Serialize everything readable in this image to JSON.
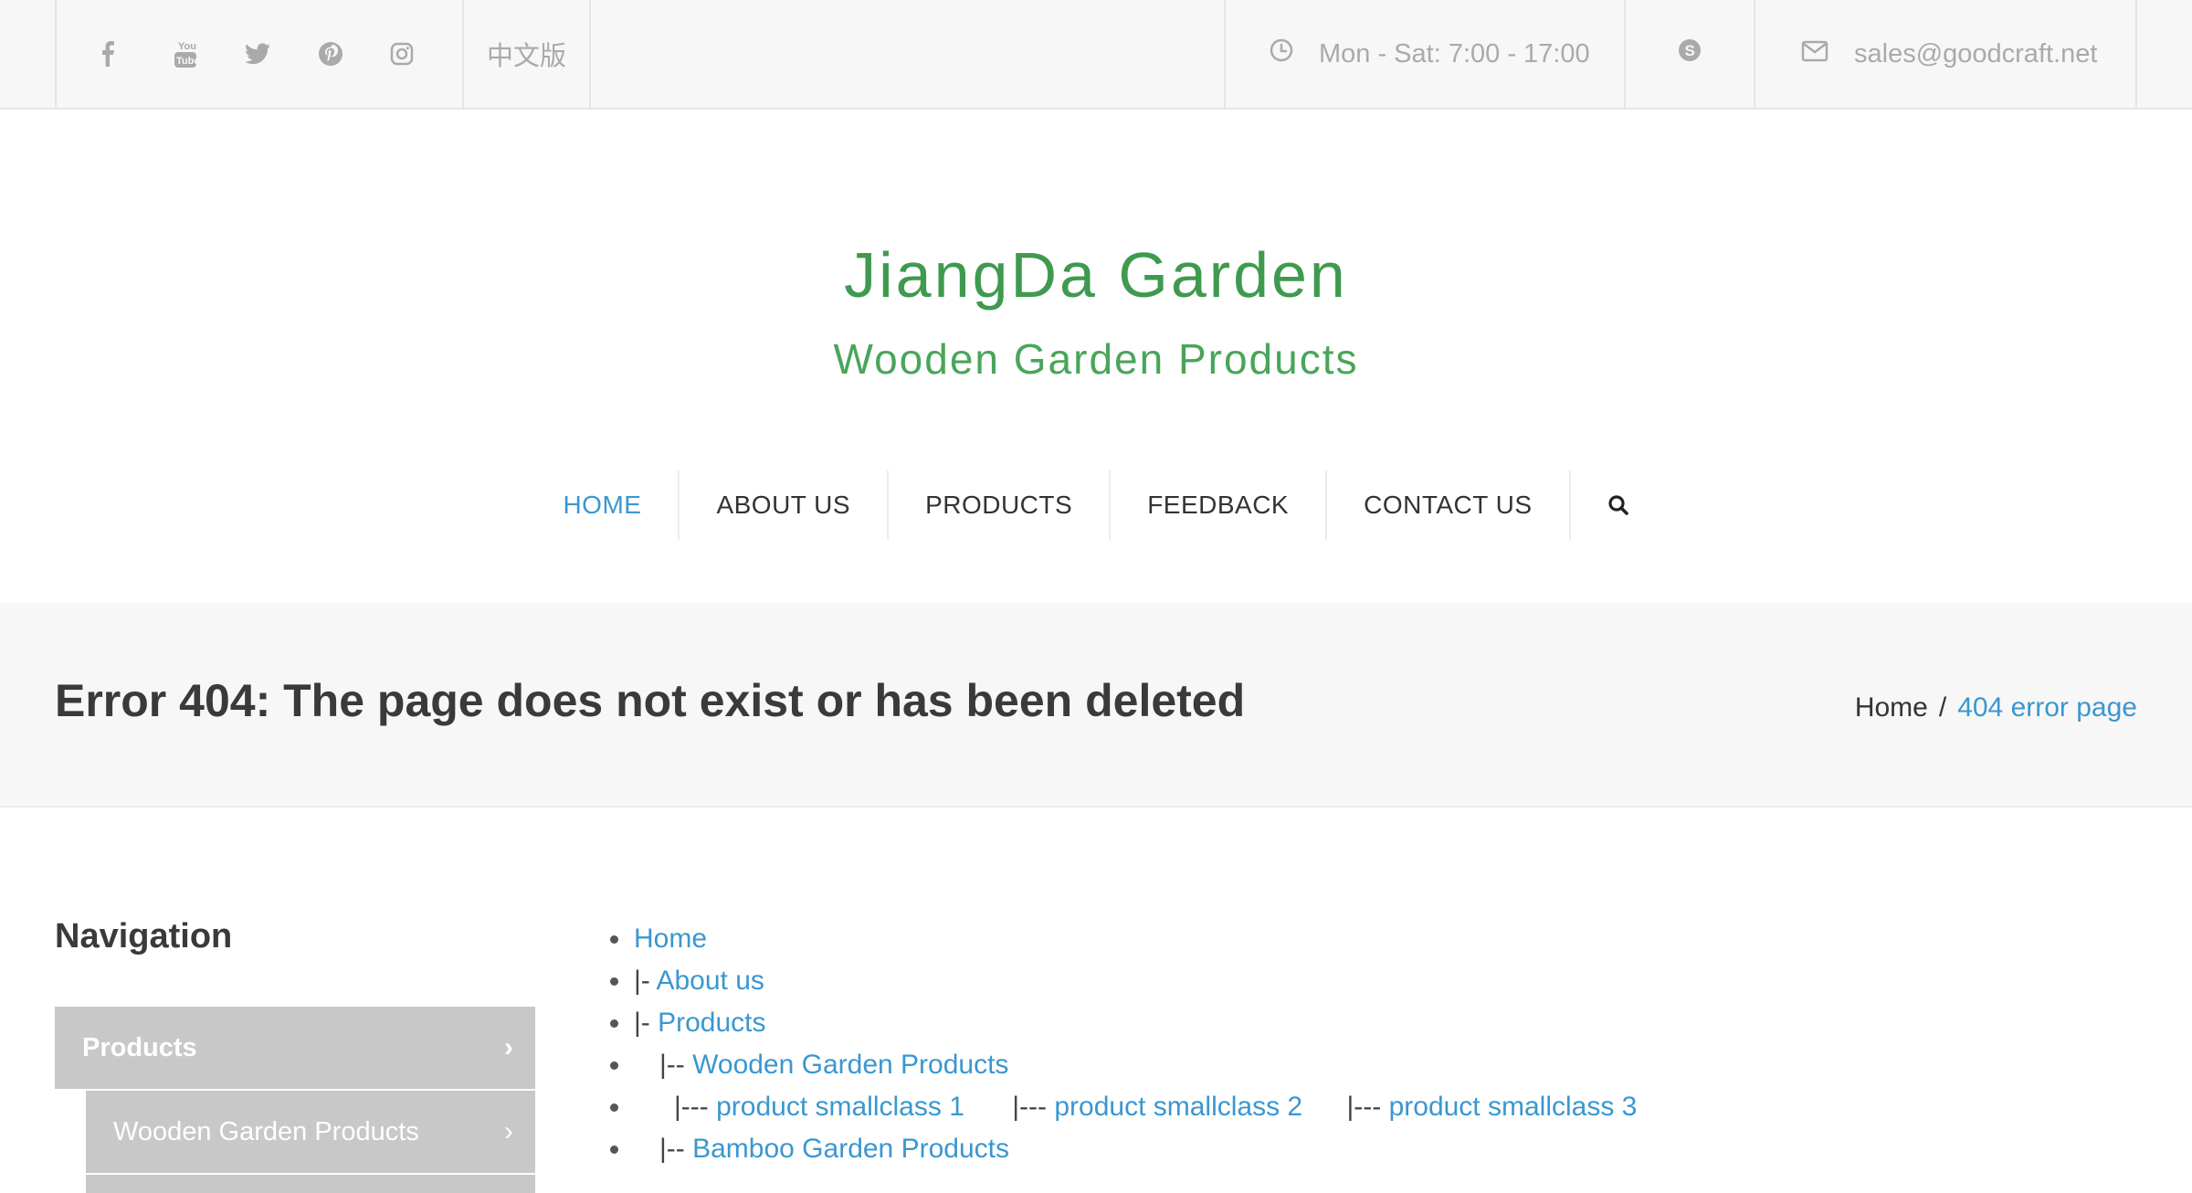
{
  "topbar": {
    "social_icons": [
      "facebook-icon",
      "youtube-icon",
      "twitter-icon",
      "pinterest-icon",
      "instagram-icon"
    ],
    "language": "中文版",
    "hours": "Mon - Sat: 7:00 - 17:00",
    "email": "sales@goodcraft.net"
  },
  "logo": {
    "line1": "JiangDa Garden",
    "line2": "Wooden Garden Products"
  },
  "nav": {
    "items": [
      {
        "label": "HOME",
        "active": true
      },
      {
        "label": "ABOUT US"
      },
      {
        "label": "PRODUCTS"
      },
      {
        "label": "FEEDBACK"
      },
      {
        "label": "CONTACT US"
      }
    ]
  },
  "title_band": {
    "title": "Error 404: The page does not exist or has been deleted",
    "breadcrumb": {
      "home": "Home",
      "sep": "/",
      "current": "404 error page"
    }
  },
  "sidebar": {
    "title": "Navigation",
    "items": [
      {
        "label": "Products"
      },
      {
        "label": "Wooden Garden Products"
      }
    ]
  },
  "sitemap": {
    "home": "Home",
    "about": {
      "prefix": "|- ",
      "label": "About us"
    },
    "products": {
      "prefix": "|- ",
      "label": "Products"
    },
    "wooden": {
      "prefix": "|-- ",
      "label": "Wooden Garden Products"
    },
    "sc1": {
      "prefix": "|--- ",
      "label": "product smallclass 1"
    },
    "sc2": {
      "prefix": "|--- ",
      "label": "product smallclass 2"
    },
    "sc3": {
      "prefix": "|--- ",
      "label": "product smallclass 3"
    },
    "bamboo": {
      "prefix": "|-- ",
      "label": "Bamboo Garden Products"
    }
  },
  "colors": {
    "accent": "#3a97cf",
    "logo_green": "#3f9a4f",
    "sidebar_bg": "#c8c8c8"
  }
}
